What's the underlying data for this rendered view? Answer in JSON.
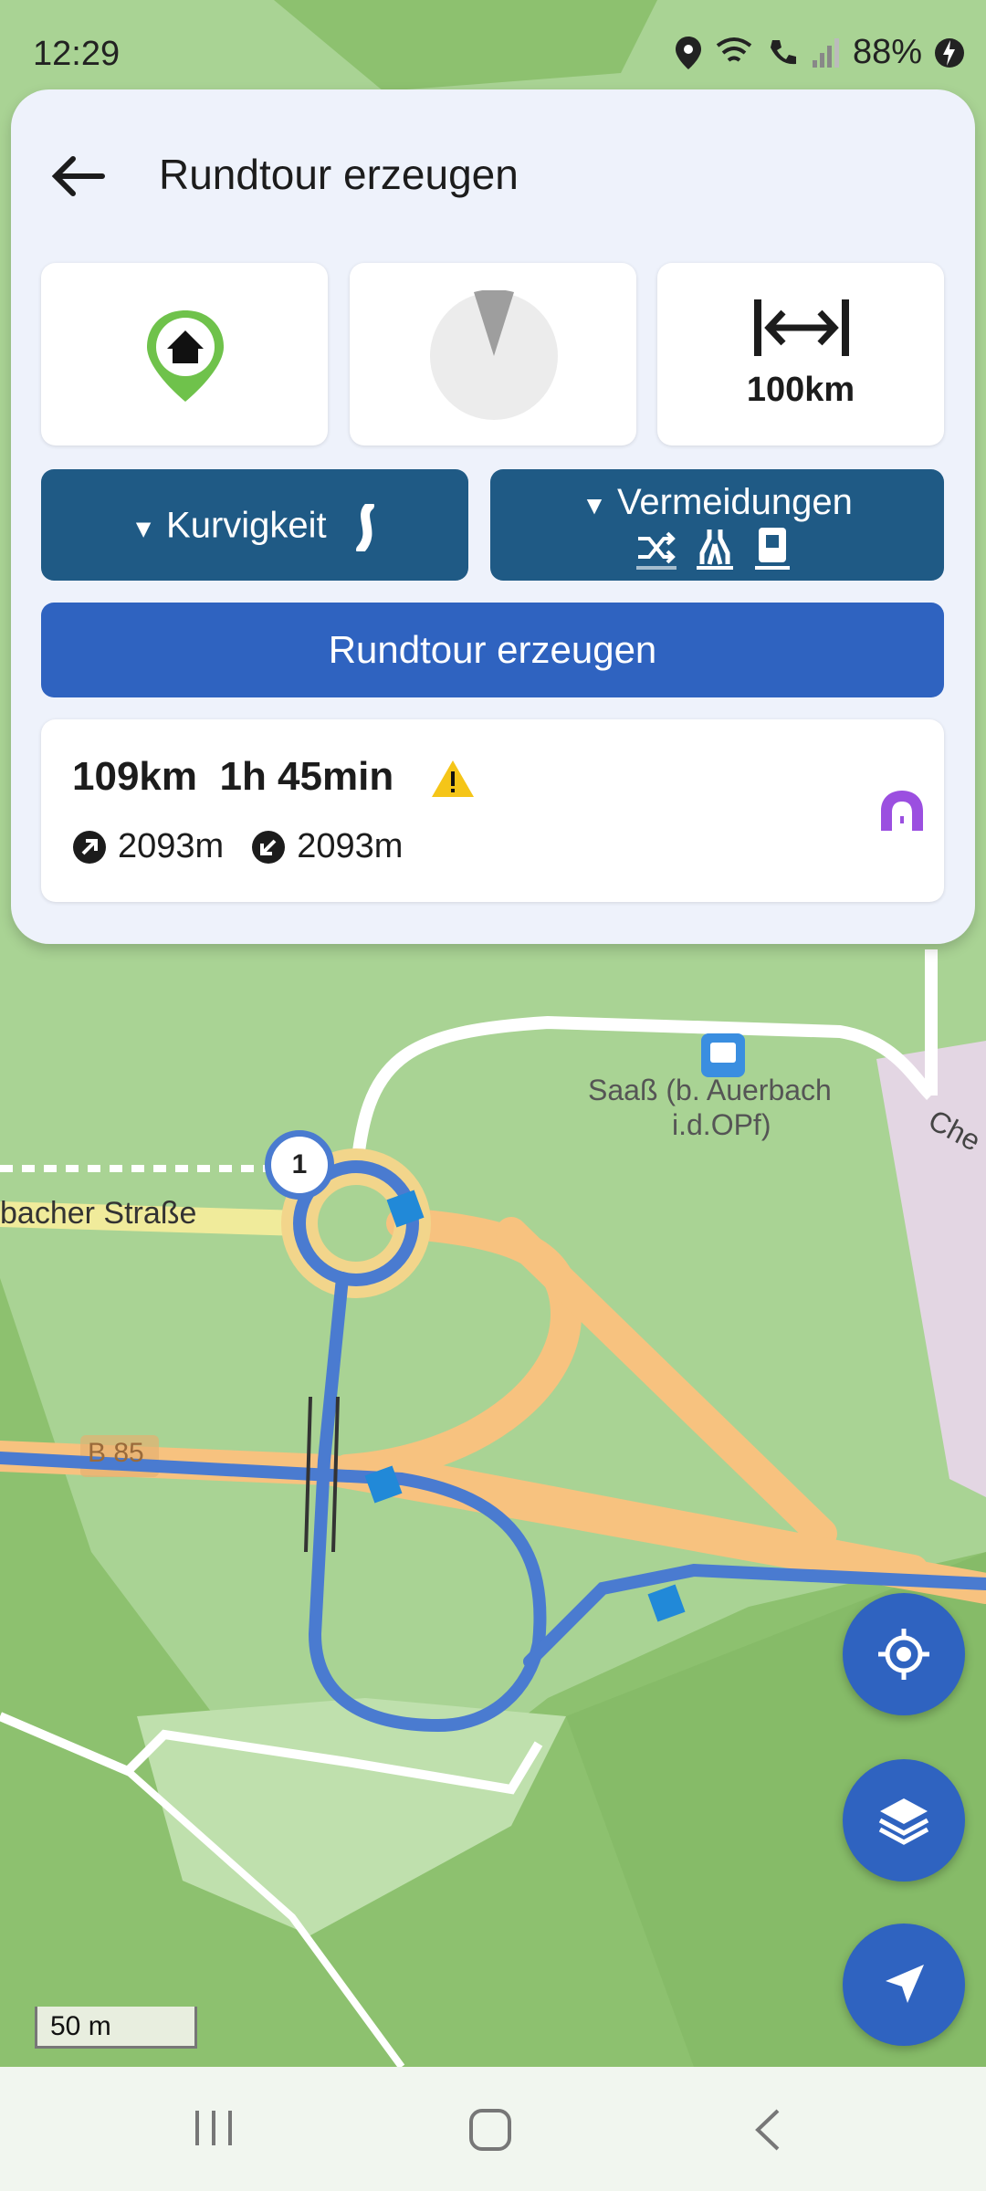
{
  "status": {
    "time": "12:29",
    "battery": "88%"
  },
  "header": {
    "title": "Rundtour erzeugen"
  },
  "options": {
    "distance": "100km",
    "curviness_label": "Kurvigkeit",
    "avoidances_label": "Vermeidungen"
  },
  "actions": {
    "generate_label": "Rundtour erzeugen"
  },
  "summary": {
    "distance": "109km",
    "duration": "1h 45min",
    "ascent": "2093m",
    "descent": "2093m"
  },
  "map": {
    "street_label": "bacher Straße",
    "road_label": "B 85",
    "stop_label_1": "Saaß (b. Auerbach",
    "stop_label_2": "i.d.OPf)",
    "partial_label": "Che",
    "waypoint_number": "1",
    "scale_label": "50 m"
  },
  "colors": {
    "primary": "#2f63c0",
    "dark_button": "#1f5a85",
    "route": "#4a7bd0",
    "road_orange": "#f7c27f",
    "map_green": "#a9d394"
  },
  "icons": {
    "back": "back-arrow-icon",
    "home": "home-pin-icon",
    "direction": "direction-dial-icon",
    "distance": "distance-arrows-icon",
    "warning": "warning-icon",
    "tunnel": "tunnel-icon",
    "locate": "locate-icon",
    "layers": "layers-icon",
    "navigate": "navigate-icon"
  }
}
